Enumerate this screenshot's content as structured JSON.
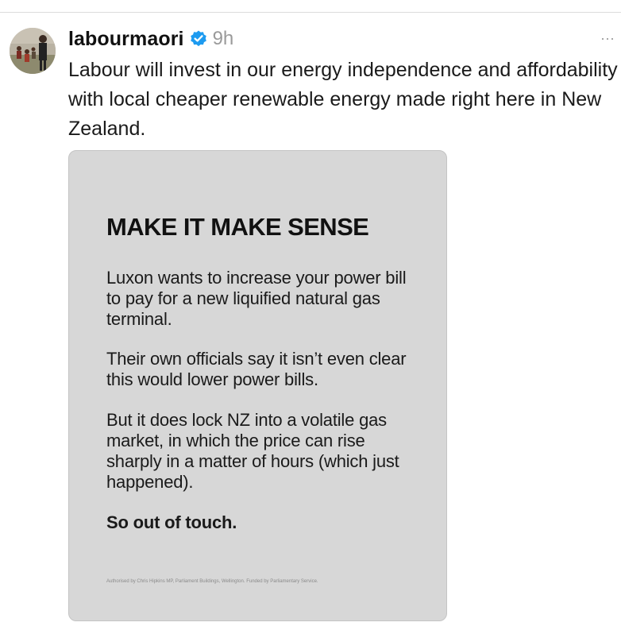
{
  "post": {
    "username": "labourmaori",
    "verified_icon": "verified-badge-icon",
    "timestamp": "9h",
    "more_icon": "more-options-icon",
    "more_label": "···",
    "caption": "Labour will invest in our energy independence and affordability with local cheaper renewable energy made right here in New Zealand.",
    "accent_color": "#1d9bf0"
  },
  "media": {
    "heading": "MAKE IT MAKE SENSE",
    "paragraphs": [
      "Luxon wants to increase your power bill to pay for a new liquified natural gas terminal.",
      "Their own officials say it isn’t even clear this would lower power bills.",
      "But it does lock NZ into a volatile gas market, in which the price can rise sharply in a matter of hours (which just happened).",
      "So out of touch."
    ],
    "footer": "Authorised by Chris Hipkins MP, Parliament Buildings, Wellington. Funded by Parliamentary Service.",
    "background_color": "#d7d7d7"
  }
}
